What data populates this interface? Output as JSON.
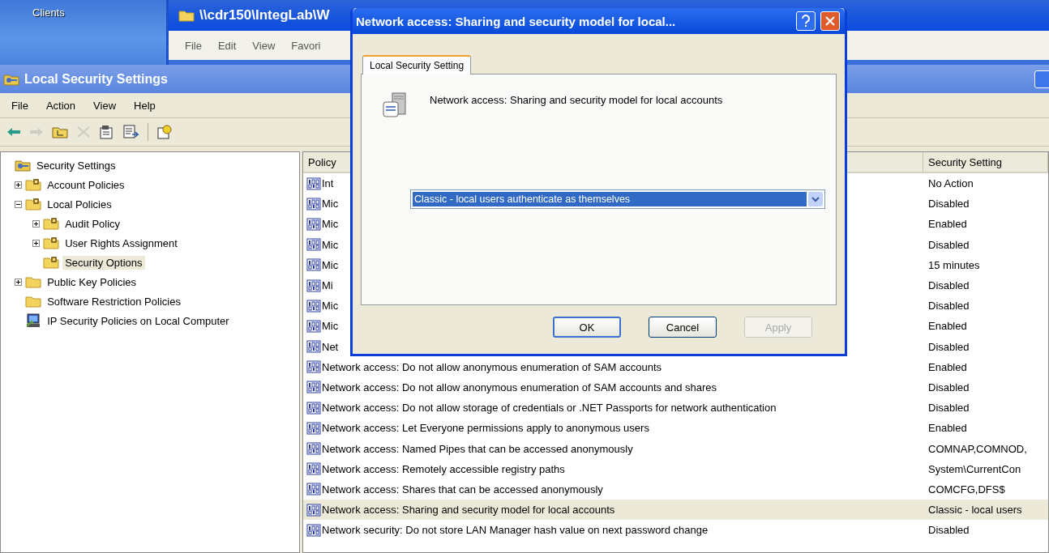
{
  "desktop": {
    "icon_label": "Clients"
  },
  "background_window": {
    "title": "\\\\cdr150\\IntegLab\\W",
    "menu": [
      "File",
      "Edit",
      "View",
      "Favori"
    ]
  },
  "window": {
    "title": "Local Security Settings",
    "menu": [
      "File",
      "Action",
      "View",
      "Help"
    ],
    "toolbar": [
      [
        {
          "kind": "back",
          "disabled": false
        },
        {
          "kind": "forward",
          "disabled": true
        },
        {
          "kind": "up",
          "disabled": false
        },
        {
          "kind": "delete",
          "disabled": true
        },
        {
          "kind": "properties",
          "disabled": false
        },
        {
          "kind": "export",
          "disabled": false
        }
      ],
      [
        {
          "kind": "help",
          "disabled": false
        }
      ]
    ]
  },
  "tree": {
    "label": "Security Settings",
    "kind": "root",
    "selected": false,
    "children": [
      {
        "label": "Account Policies",
        "kind": "policy",
        "expanded": false,
        "selected": false
      },
      {
        "label": "Local Policies",
        "kind": "policy",
        "expanded": true,
        "selected": false,
        "children": [
          {
            "label": "Audit Policy",
            "kind": "policy",
            "expanded": false,
            "selected": false
          },
          {
            "label": "User Rights Assignment",
            "kind": "policy",
            "expanded": false,
            "selected": false
          },
          {
            "label": "Security Options",
            "kind": "policy",
            "selected": true
          }
        ]
      },
      {
        "label": "Public Key Policies",
        "kind": "folder",
        "expanded": false,
        "selected": false
      },
      {
        "label": "Software Restriction Policies",
        "kind": "folder",
        "selected": false
      },
      {
        "label": "IP Security Policies on Local Computer",
        "kind": "computer",
        "selected": false
      }
    ]
  },
  "table": {
    "columns": [
      "Policy",
      "Security Setting"
    ],
    "rows": [
      {
        "policy": "Int",
        "setting": "No Action",
        "selected": false
      },
      {
        "policy": "Mic",
        "setting": "Disabled",
        "selected": false
      },
      {
        "policy": "Mic",
        "setting": "Enabled",
        "selected": false
      },
      {
        "policy": "Mic",
        "setting": "Disabled",
        "selected": false
      },
      {
        "policy": "Mic",
        "setting": "15 minutes",
        "selected": false
      },
      {
        "policy": "Mi",
        "setting": "Disabled",
        "selected": false
      },
      {
        "policy": "Mic",
        "setting": "Disabled",
        "selected": false
      },
      {
        "policy": "Mic",
        "setting": "Enabled",
        "selected": false
      },
      {
        "policy": "Net",
        "setting": "Disabled",
        "selected": false
      },
      {
        "policy": "Network access: Do not allow anonymous enumeration of SAM accounts",
        "setting": "Enabled",
        "selected": false
      },
      {
        "policy": "Network access: Do not allow anonymous enumeration of SAM accounts and shares",
        "setting": "Disabled",
        "selected": false
      },
      {
        "policy": "Network access: Do not allow storage of credentials or .NET Passports for network authentication",
        "setting": "Disabled",
        "selected": false
      },
      {
        "policy": "Network access: Let Everyone permissions apply to anonymous users",
        "setting": "Enabled",
        "selected": false
      },
      {
        "policy": "Network access: Named Pipes that can be accessed anonymously",
        "setting": "COMNAP,COMNOD,",
        "selected": false
      },
      {
        "policy": "Network access: Remotely accessible registry paths",
        "setting": "System\\CurrentCon",
        "selected": false
      },
      {
        "policy": "Network access: Shares that can be accessed anonymously",
        "setting": "COMCFG,DFS$",
        "selected": false
      },
      {
        "policy": "Network access: Sharing and security model for local accounts",
        "setting": "Classic - local users",
        "selected": true
      },
      {
        "policy": "Network security: Do not store LAN Manager hash value on next password change",
        "setting": "Disabled",
        "selected": false
      }
    ]
  },
  "dialog": {
    "title": "Network access: Sharing and security model for local...",
    "tabs": [
      {
        "label": "Local Security Setting",
        "selected": true
      }
    ],
    "description": "Network access: Sharing and security model for local accounts",
    "combobox": {
      "value": "Classic - local users authenticate as themselves"
    },
    "buttons": [
      {
        "label": "OK",
        "disabled": false
      },
      {
        "label": "Cancel",
        "disabled": false
      },
      {
        "label": "Apply",
        "disabled": true
      }
    ]
  }
}
